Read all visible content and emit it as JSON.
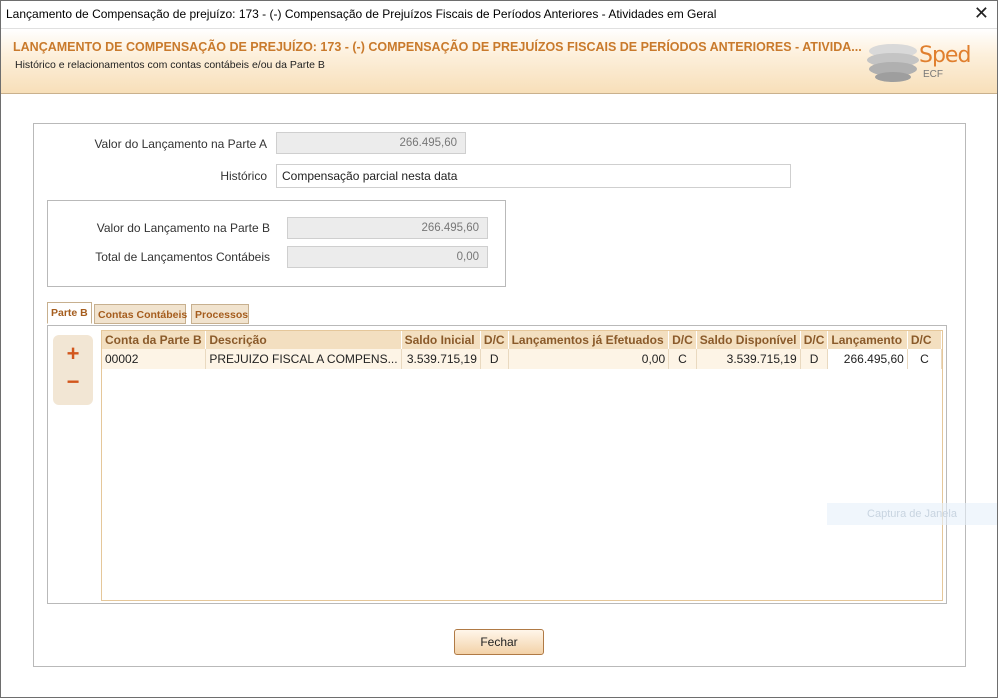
{
  "window": {
    "title": "Lançamento de Compensação de prejuízo: 173 - (-) Compensação de Prejuízos Fiscais de Períodos Anteriores - Atividades em Geral",
    "close_glyph": "✕"
  },
  "header": {
    "title": "LANÇAMENTO DE COMPENSAÇÃO DE PREJUÍZO: 173 - (-) COMPENSAÇÃO DE PREJUÍZOS FISCAIS DE PERÍODOS ANTERIORES - ATIVIDA...",
    "subtitle": "Histórico e relacionamentos com contas contábeis e/ou da Parte B",
    "logo_text": "Sped",
    "logo_sub": "ECF",
    "brand_color": "#e07f2e"
  },
  "form": {
    "valor_parte_a_label": "Valor do Lançamento na Parte A",
    "valor_parte_a": "266.495,60",
    "historico_label": "Histórico",
    "historico": "Compensação parcial nesta data",
    "valor_parte_b_label": "Valor do Lançamento na Parte B",
    "valor_parte_b": "266.495,60",
    "total_contabeis_label": "Total de Lançamentos Contábeis",
    "total_contabeis": "0,00"
  },
  "tabs": [
    {
      "label": "Parte B",
      "active": true
    },
    {
      "label": "Contas Contábeis",
      "active": false
    },
    {
      "label": "Processos",
      "active": false
    }
  ],
  "side_buttons": {
    "add": "+",
    "remove": "−"
  },
  "grid": {
    "columns": [
      "Conta da Parte B",
      "Descrição",
      "Saldo Inicial",
      "D/C",
      "Lançamentos já Efetuados",
      "D/C",
      "Saldo Disponível",
      "D/C",
      "Lançamento",
      "D/C"
    ],
    "rows": [
      [
        "00002",
        "PREJUIZO FISCAL A COMPENS...",
        "3.539.715,19",
        "D",
        "0,00",
        "C",
        "3.539.715,19",
        "D",
        "266.495,60",
        "C"
      ]
    ]
  },
  "watermark": "Captura de Janela",
  "footer": {
    "close_button": "Fechar"
  }
}
